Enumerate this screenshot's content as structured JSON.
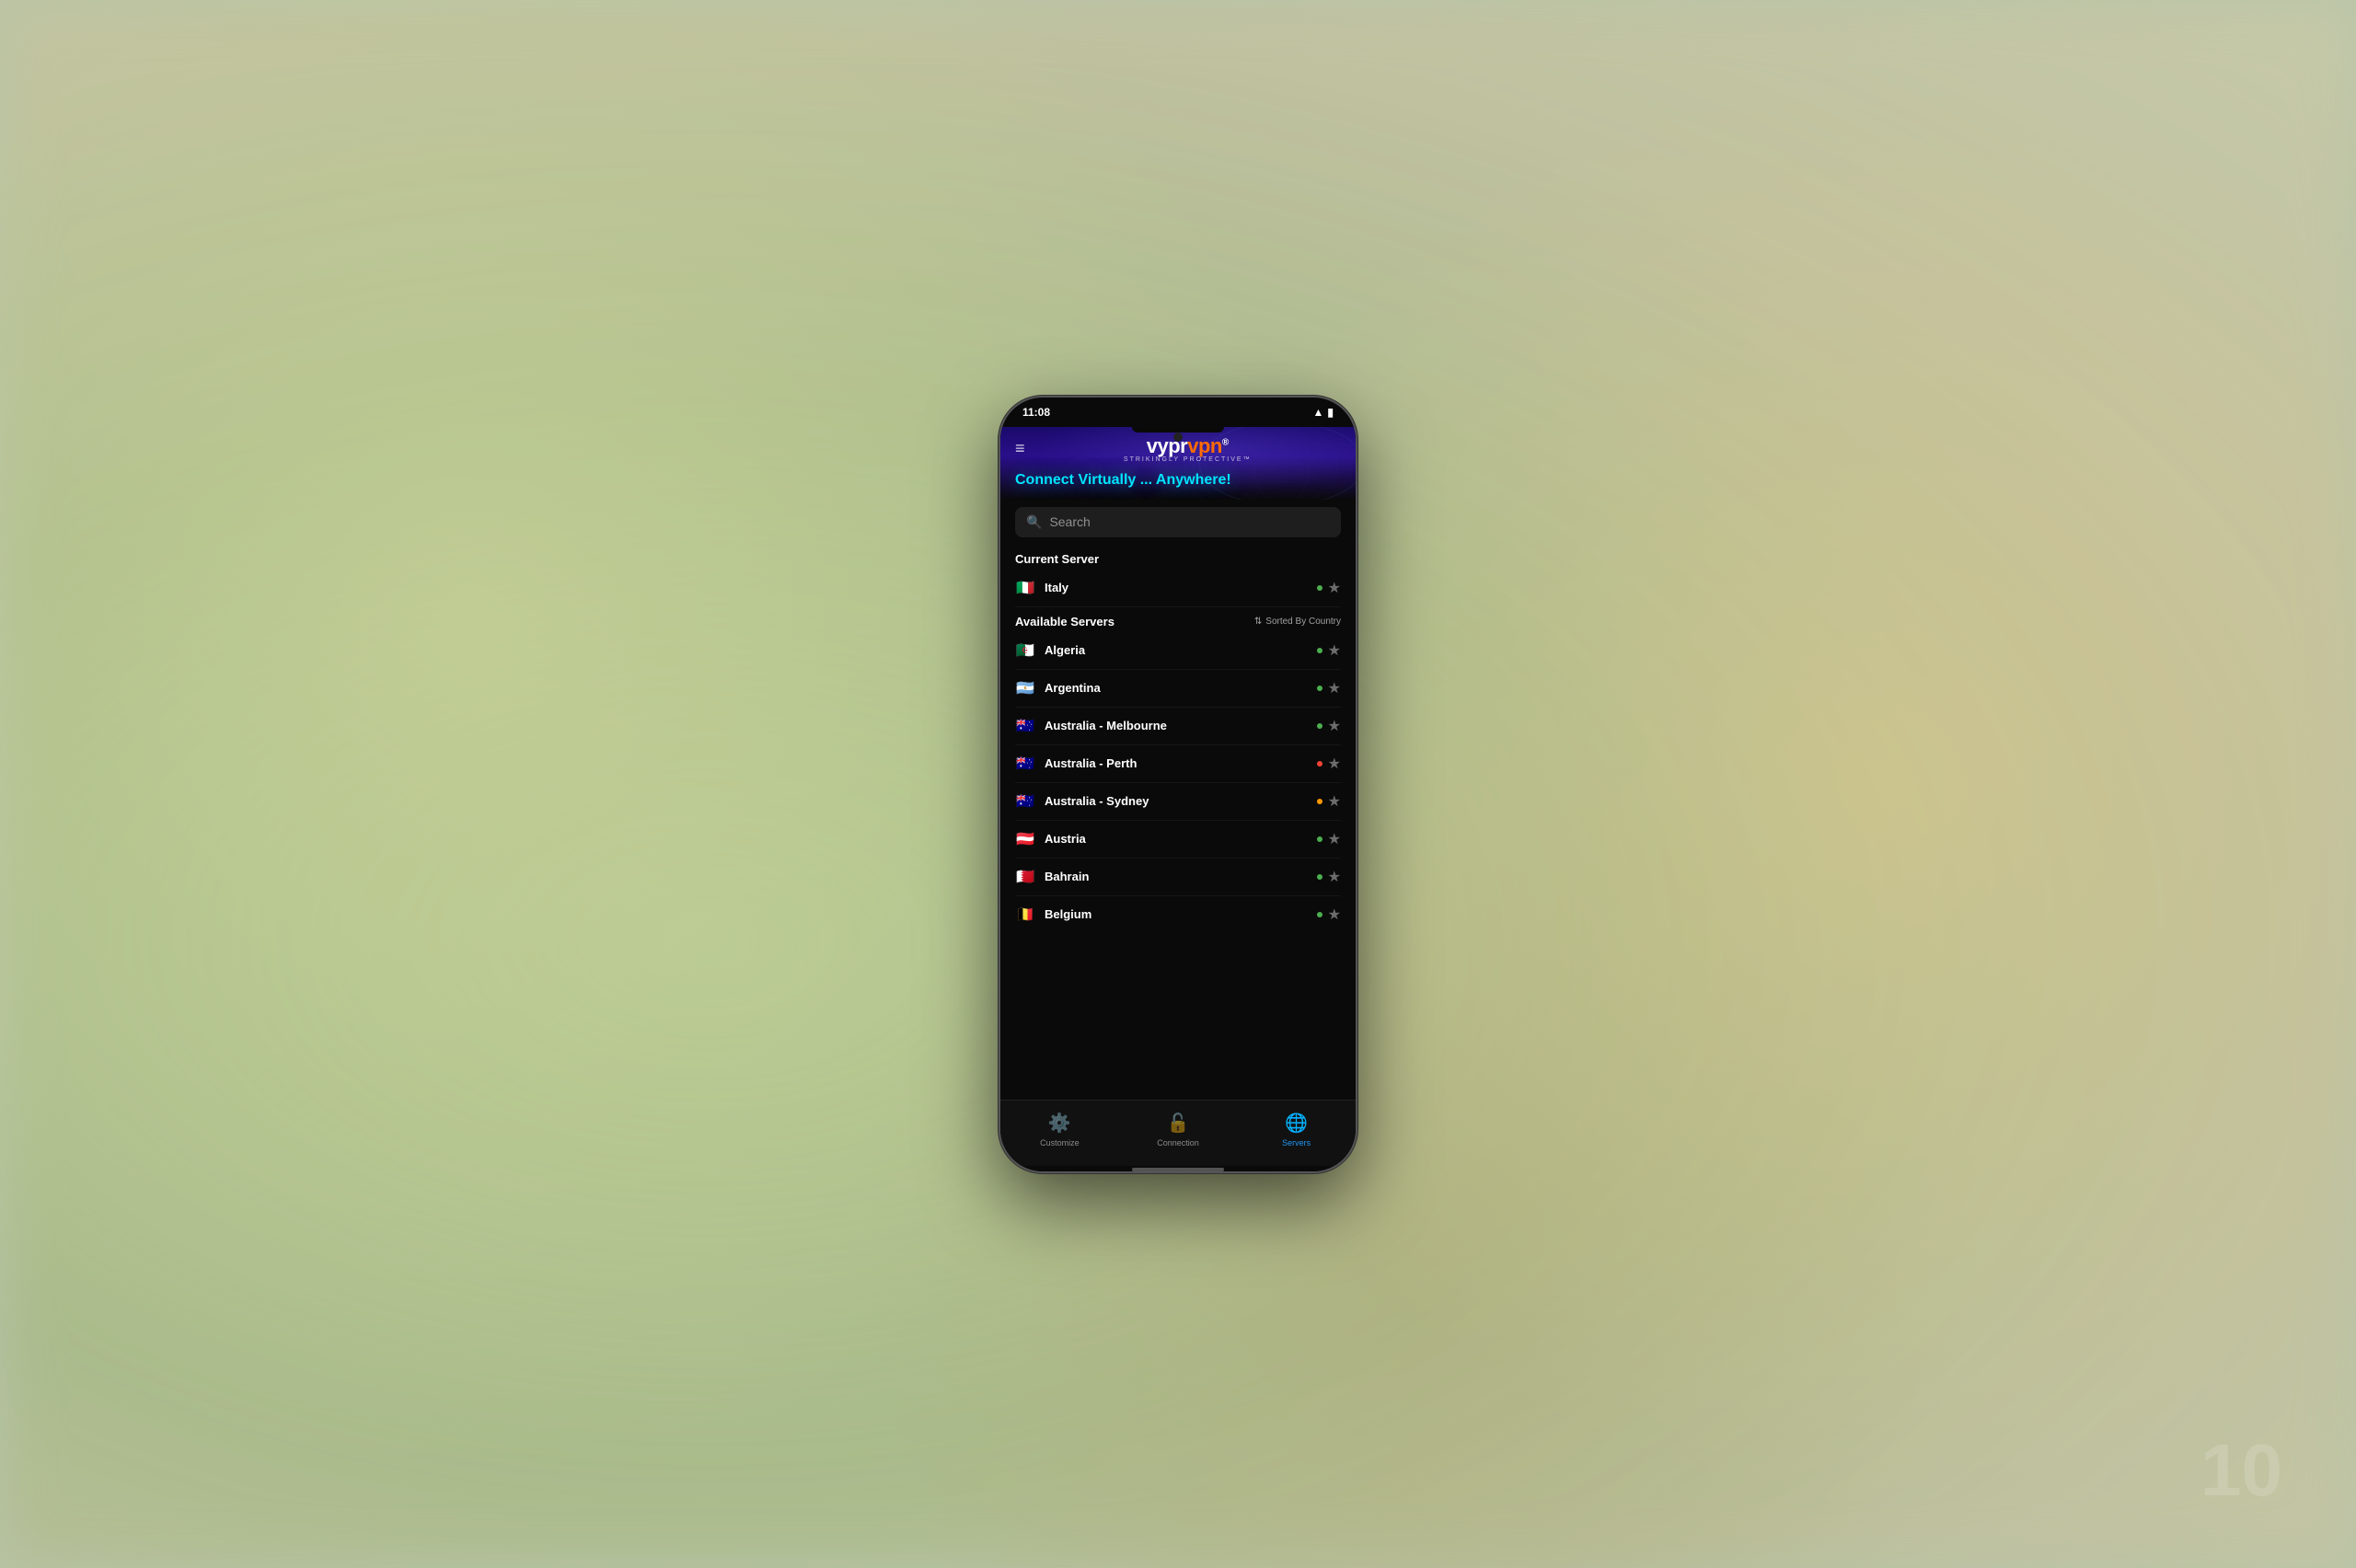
{
  "statusBar": {
    "time": "11:08",
    "wifiIcon": "wifi",
    "batteryIcon": "battery"
  },
  "header": {
    "menuIcon": "≡",
    "logoMain": "vypr",
    "logoVpn": "vpn",
    "logoR": "®",
    "tagline": "STRIKINGLY PROTECTIVE™",
    "banner": "Connect Virtually ... Anywhere!"
  },
  "search": {
    "placeholder": "Search",
    "icon": "🔍"
  },
  "currentServer": {
    "sectionTitle": "Current Server",
    "name": "Italy",
    "flag": "🇮🇹",
    "dotColor": "green"
  },
  "availableServers": {
    "sectionTitle": "Available Servers",
    "sortLabel": "Sorted By Country",
    "sortIcon": "⇅",
    "items": [
      {
        "name": "Algeria",
        "flag": "🇩🇿",
        "dotColor": "green"
      },
      {
        "name": "Argentina",
        "flag": "🇦🇷",
        "dotColor": "green"
      },
      {
        "name": "Australia - Melbourne",
        "flag": "🇦🇺",
        "dotColor": "green"
      },
      {
        "name": "Australia - Perth",
        "flag": "🇦🇺",
        "dotColor": "red"
      },
      {
        "name": "Australia - Sydney",
        "flag": "🇦🇺",
        "dotColor": "orange"
      },
      {
        "name": "Austria",
        "flag": "🇦🇹",
        "dotColor": "green"
      },
      {
        "name": "Bahrain",
        "flag": "🇧🇭",
        "dotColor": "green"
      },
      {
        "name": "Belgium",
        "flag": "🇧🇪",
        "dotColor": "green"
      }
    ]
  },
  "bottomNav": {
    "items": [
      {
        "id": "customize",
        "label": "Customize",
        "icon": "⚙",
        "active": false
      },
      {
        "id": "connection",
        "label": "Connection",
        "icon": "🔓",
        "active": false
      },
      {
        "id": "servers",
        "label": "Servers",
        "icon": "🌐",
        "active": true
      }
    ]
  },
  "watermark": "10"
}
